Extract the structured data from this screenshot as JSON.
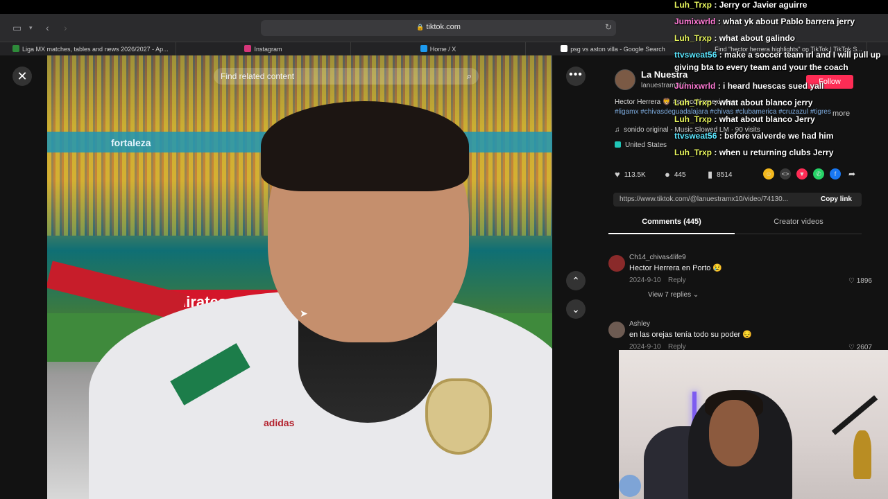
{
  "browser": {
    "url": "tiktok.com",
    "lock_glyph": "🔒",
    "tabs": [
      {
        "label": "Liga MX matches, tables and news 2026/2027 - Ap...",
        "favicon_color": "#2e8b3a"
      },
      {
        "label": "Instagram",
        "favicon_color": "#d6367a"
      },
      {
        "label": "Home / X",
        "favicon_color": "#1d9bf0"
      },
      {
        "label": "psg vs aston villa - Google Search",
        "favicon_color": "#ffffff"
      },
      {
        "label": "Find \"hector herrera highlights\" on TikTok | TikTok S...",
        "favicon_color": "#222222"
      }
    ]
  },
  "video": {
    "search_placeholder": "Find related content",
    "close_glyph": "✕",
    "more_glyph": "•••",
    "up_glyph": "⌃",
    "down_glyph": "⌄",
    "banner_text": "fortaleza",
    "board_text": "Emirates",
    "sponsor_text": "adidas"
  },
  "author": {
    "name": "La Nuestra",
    "handle": "lanuestramx10",
    "follow_label": "Follow",
    "description": "Hector Herrera 🦁 #selecciónmexicana",
    "tags": "#ligamx #chivasdeguadalajara #chivas #clubamerica #cruzazul #tigres",
    "more_label": "more",
    "music": "sonido original - Music Slowed LM · 90 visits",
    "location": "United States"
  },
  "stats": {
    "likes": "113.5K",
    "comments": "445",
    "saves": "8514"
  },
  "link": {
    "url": "https://www.tiktok.com/@lanuestramx10/video/74130...",
    "copy_label": "Copy link"
  },
  "tabs": {
    "comments": "Comments (445)",
    "creator": "Creator videos"
  },
  "comments": [
    {
      "user": "Ch14_chivas4life9",
      "text": "Hector Herrera en Porto 😢",
      "date": "2024-9-10",
      "reply": "Reply",
      "likes": "1896",
      "view_replies": "View 7 replies",
      "avatar_color": "#8a2a2a"
    },
    {
      "user": "Ashley",
      "text": "en las orejas tenía todo su poder 😔",
      "date": "2024-9-10",
      "reply": "Reply",
      "likes": "2607",
      "avatar_color": "#6d5b52"
    }
  ],
  "chat": [
    {
      "user": "Luh_Trxp",
      "msg": "Jerry or Javier aguirre",
      "color": "yellow"
    },
    {
      "user": "Jumixwrld",
      "msg": "what yk about Pablo barrera jerry",
      "color": "pink"
    },
    {
      "user": "Luh_Trxp",
      "msg": "what about galindo",
      "color": "yellow"
    },
    {
      "user": "ttvsweat56",
      "msg": "make a soccer team irl and I will pull up giving bta to every team and your the coach",
      "color": "cyan"
    },
    {
      "user": "Jumixwrld",
      "msg": "i heard huescas sued yall",
      "color": "pink"
    },
    {
      "user": "Luh_Trxp",
      "msg": "what about blanco jerry",
      "color": "yellow"
    },
    {
      "user": "Luh_Trxp",
      "msg": "what about blanco Jerry",
      "color": "yellow"
    },
    {
      "user": "ttvsweat56",
      "msg": "before valverde we had him",
      "color": "cyan"
    },
    {
      "user": "Luh_Trxp",
      "msg": "when u returning clubs Jerry",
      "color": "yellow"
    }
  ]
}
